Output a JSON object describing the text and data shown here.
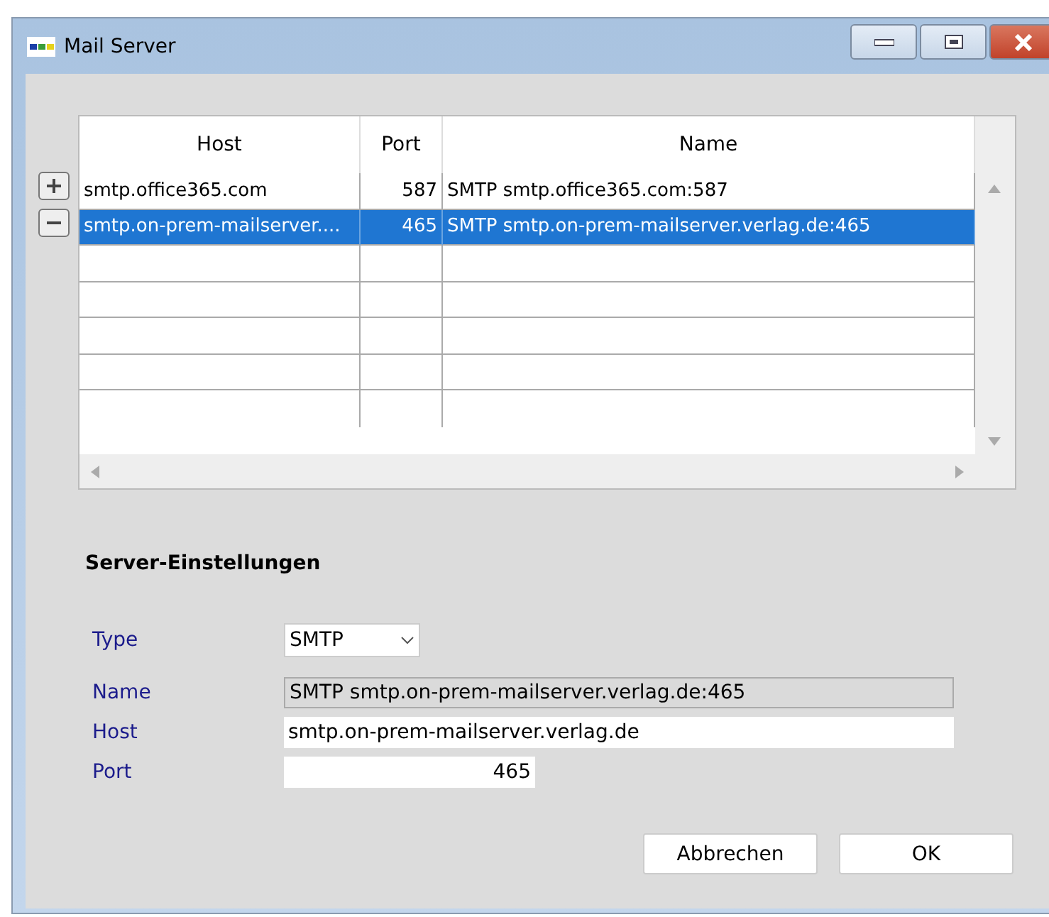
{
  "window": {
    "title": "Mail Server"
  },
  "table": {
    "columns": [
      "Host",
      "Port",
      "Name"
    ],
    "rows": [
      {
        "host": "smtp.office365.com",
        "port": "587",
        "name": "SMTP smtp.office365.com:587",
        "selected": false
      },
      {
        "host": "smtp.on-prem-mailserver....",
        "port": "465",
        "name": "SMTP smtp.on-prem-mailserver.verlag.de:465",
        "selected": true
      }
    ]
  },
  "settings": {
    "heading": "Server-Einstellungen",
    "fields": [
      {
        "label": "Type",
        "kind": "dropdown",
        "value": "SMTP"
      },
      {
        "label": "Name",
        "kind": "readonly",
        "value": "SMTP smtp.on-prem-mailserver.verlag.de:465"
      },
      {
        "label": "Host",
        "kind": "text",
        "value": "smtp.on-prem-mailserver.verlag.de"
      },
      {
        "label": "Port",
        "kind": "number",
        "value": "465"
      }
    ]
  },
  "buttons": [
    "Abbrechen",
    "OK"
  ]
}
